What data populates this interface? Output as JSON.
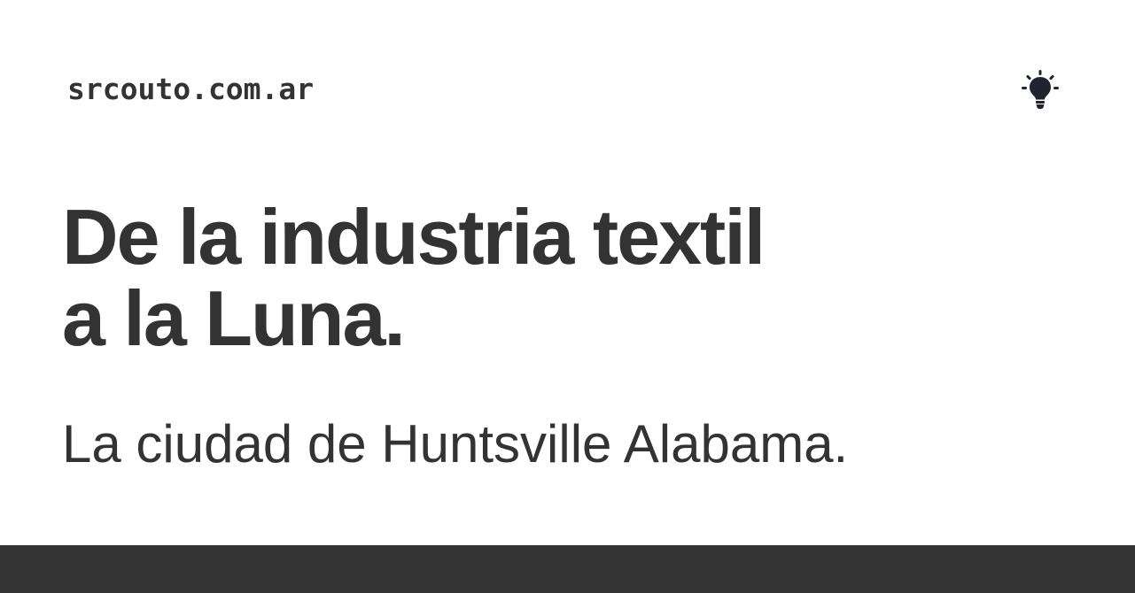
{
  "header": {
    "site_name": "srcouto.com.ar",
    "theme_icon": "lightbulb-icon"
  },
  "main": {
    "title_line_1": "De la industria textil",
    "title_line_2": "a la Luna.",
    "subtitle": "La ciudad de Huntsville Alabama."
  },
  "colors": {
    "text": "#333333",
    "background": "#ffffff",
    "footer": "#333333"
  }
}
